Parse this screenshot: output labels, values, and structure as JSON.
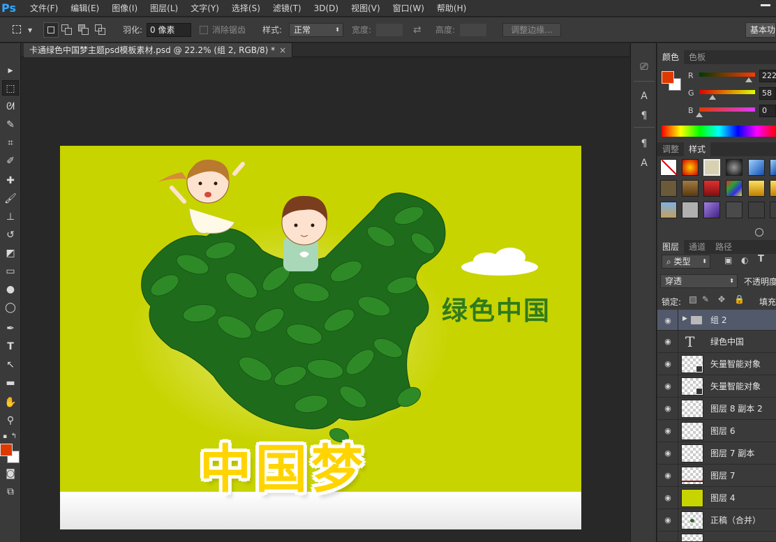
{
  "app": {
    "logo": "Ps"
  },
  "menu": [
    "文件(F)",
    "编辑(E)",
    "图像(I)",
    "图层(L)",
    "文字(Y)",
    "选择(S)",
    "滤镜(T)",
    "3D(D)",
    "视图(V)",
    "窗口(W)",
    "帮助(H)"
  ],
  "options": {
    "feather_label": "羽化:",
    "feather_value": "0 像素",
    "antialias_label": "消除锯齿",
    "style_label": "样式:",
    "style_value": "正常",
    "width_label": "宽度:",
    "height_label": "高度:",
    "refine_button": "调整边缘...",
    "workspace": "基本功能"
  },
  "document": {
    "tab_title": "卡通绿色中国梦主题psd模板素材.psd @ 22.2% (组 2, RGB/8) *",
    "close_glyph": "×"
  },
  "artwork": {
    "headline": "绿色中国",
    "title": "中国梦"
  },
  "colors": {
    "foreground": "#de3a00",
    "background": "#ffffff",
    "artwork_bg": "#c8d400",
    "layer_selected": "#52596b"
  },
  "color_panel": {
    "tabs": [
      "颜色",
      "色板"
    ],
    "r_label": "R",
    "g_label": "G",
    "b_label": "B",
    "r": "222",
    "g": "58",
    "b": "0"
  },
  "styles_panel": {
    "tabs": [
      "调整",
      "样式"
    ]
  },
  "layers_panel": {
    "tabs": [
      "图层",
      "通道",
      "路径"
    ],
    "filter_kind": "类型",
    "blend_mode": "穿透",
    "opacity_label": "不透明度",
    "lock_label": "锁定:",
    "fill_label": "填充",
    "layers": [
      {
        "name": "组 2",
        "kind": "group",
        "selected": true
      },
      {
        "name": "绿色中国",
        "kind": "text"
      },
      {
        "name": "矢量智能对象",
        "kind": "smart"
      },
      {
        "name": "矢量智能对象",
        "kind": "smart"
      },
      {
        "name": "图层 8 副本 2",
        "kind": "pixel"
      },
      {
        "name": "图层 6",
        "kind": "pixel"
      },
      {
        "name": "图层 7 副本",
        "kind": "pixel"
      },
      {
        "name": "图层 7",
        "kind": "pixel-line"
      },
      {
        "name": "图层 4",
        "kind": "fill"
      },
      {
        "name": "正稿（合并）",
        "kind": "pixel-art"
      }
    ]
  }
}
